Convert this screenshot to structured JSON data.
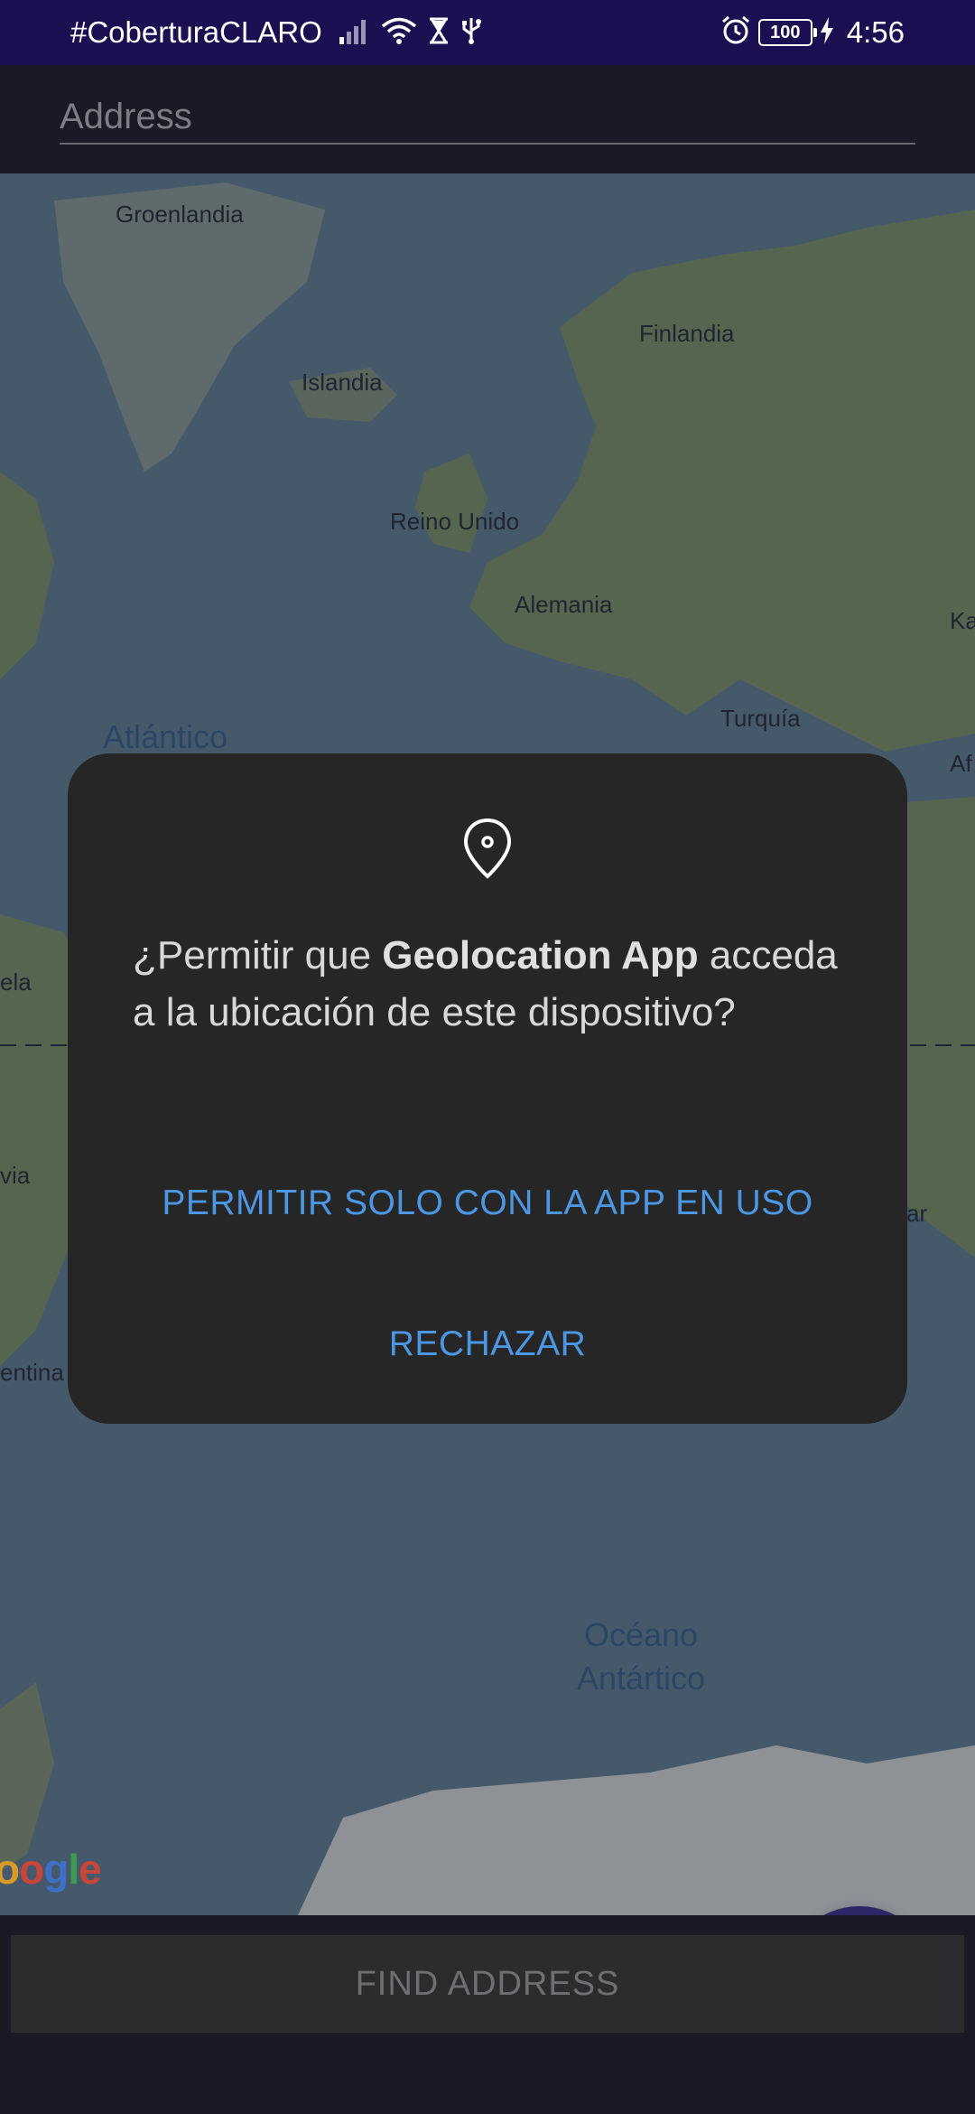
{
  "status_bar": {
    "carrier": "#CoberturaCLARO",
    "battery": "100",
    "time": "4:56",
    "icons_left": [
      "signal-icon",
      "wifi-icon",
      "hourglass-icon",
      "usb-icon"
    ],
    "icons_right": [
      "alarm-icon",
      "battery-icon",
      "charging-icon"
    ]
  },
  "address": {
    "value": "",
    "placeholder": "Address"
  },
  "map": {
    "labels": {
      "groenlandia": "Groenlandia",
      "finlandia": "Finlandia",
      "islandia": "Islandia",
      "reino_unido": "Reino Unido",
      "alemania": "Alemania",
      "turquia": "Turquía",
      "atlantico": "Atlántico",
      "ka": "Ka",
      "af": "Af",
      "ela": "ela",
      "via": "via",
      "ar": "ar",
      "entina": "entina",
      "oceano_antartico_1": "Océano",
      "oceano_antartico_2": "Antártico"
    },
    "attribution": {
      "o1": "o",
      "o2": "o",
      "g": "g",
      "l": "l",
      "e": "e"
    }
  },
  "fab": {
    "label": "+"
  },
  "find_button": {
    "label": "FIND ADDRESS"
  },
  "dialog": {
    "message_prefix": "¿Permitir que ",
    "app_name": "Geolocation App",
    "message_suffix": " acceda a la ubicación de este dispositivo?",
    "allow_label": "PERMITIR SOLO CON LA APP EN USO",
    "deny_label": "RECHAZAR"
  },
  "colors": {
    "status_bar": "#1b0f52",
    "app_background": "#1b1925",
    "dialog_background": "#262626",
    "dialog_button_text": "#4c97e4",
    "fab": "#2e2966"
  }
}
